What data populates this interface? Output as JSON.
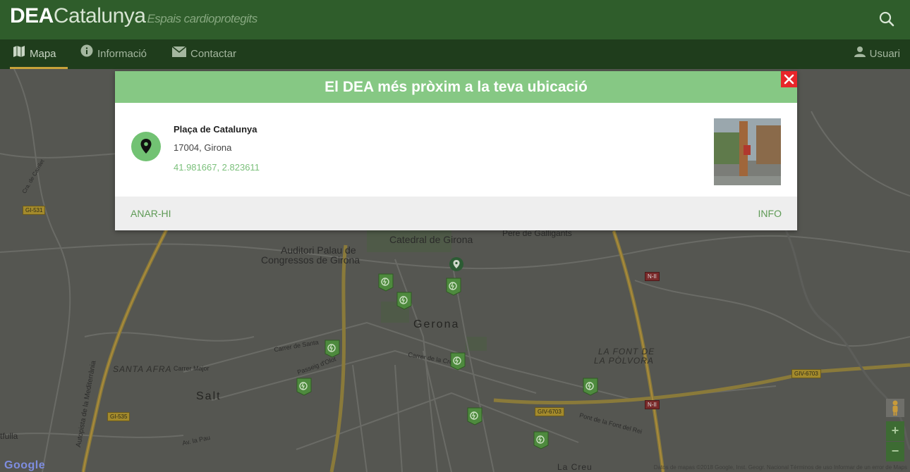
{
  "header": {
    "logo_bold": "DEA",
    "logo_light": "Catalunya",
    "tagline": "Espais cardioprotegits",
    "search_icon": "search-icon"
  },
  "nav": {
    "items": [
      {
        "label": "Mapa",
        "icon": "map-icon",
        "active": true
      },
      {
        "label": "Informació",
        "icon": "info-icon",
        "active": false
      },
      {
        "label": "Contactar",
        "icon": "mail-icon",
        "active": false
      }
    ],
    "user_label": "Usuari"
  },
  "modal": {
    "title": "El DEA més pròxim a la teva ubicació",
    "place_name": "Plaça de Catalunya",
    "address": "17004, Girona",
    "coordinates": "41.981667, 2.823611",
    "go_label": "ANAR-HI",
    "info_label": "INFO",
    "close_icon": "close-icon",
    "pin_icon": "location-pin-icon"
  },
  "map": {
    "labels": {
      "catedral": "Catedral de Girona",
      "pere": "Pere de Galligants",
      "auditori_1": "Auditori Palau de",
      "auditori_2": "Congressos de Girona",
      "gerona": "Gerona",
      "font_1": "LA FONT DE",
      "font_2": "LA PÒLVORA",
      "santa_afra": "SANTA AFRA",
      "salt": "Salt",
      "carrer_major": "Carrer Major",
      "passeig": "Passeig d'Olot",
      "carrer_santa": "Carrer de Santa",
      "carrer_creu": "Carrer de la Creu",
      "autopista": "Autopista de la Mediterrània",
      "av_pau": "Av. la Pau",
      "pont": "Pont de la Font del Rei",
      "la_creu": "La Creu",
      "cra_carrilet": "Cra. de Carrilet",
      "tfulla": "tfulla"
    },
    "road_badges": [
      "GI-531",
      "GI-535",
      "GIV-6703",
      "GIV-6703",
      "N-II",
      "N-II"
    ],
    "zoom_in": "+",
    "zoom_out": "−",
    "google": "Google",
    "attribution": "Datos de mapas ©2018 Google, Inst. Geogr. Nacional   Términos de uso   Informar de un error de Maps"
  }
}
